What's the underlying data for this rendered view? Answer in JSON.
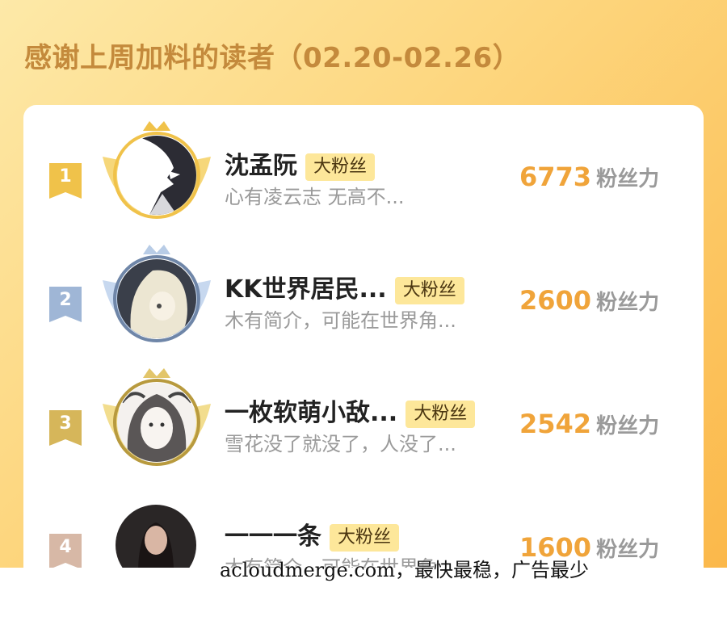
{
  "header": {
    "title": "感谢上周加料的读者（02.20-02.26）"
  },
  "colors": {
    "gold": "#f0c24a",
    "silver": "#9fb6d6",
    "bronze": "#d6b65a",
    "fourth": "#d7b8a6",
    "score": "#f0a43a"
  },
  "readers": [
    {
      "rank": "1",
      "name": "沈孟阮",
      "badge": "大粉丝",
      "bio": "心有凌云志 无高不...",
      "score": "6773",
      "score_label": "粉丝力",
      "avatar_icon": "anime-boy-avatar"
    },
    {
      "rank": "2",
      "name": "KK世界居民...",
      "badge": "大粉丝",
      "bio": "木有简介，可能在世界角...",
      "score": "2600",
      "score_label": "粉丝力",
      "avatar_icon": "anime-girl-avatar"
    },
    {
      "rank": "3",
      "name": "一枚软萌小敌...",
      "badge": "大粉丝",
      "bio": "雪花没了就没了，人没了...",
      "score": "2542",
      "score_label": "粉丝力",
      "avatar_icon": "sketch-girl-avatar"
    },
    {
      "rank": "4",
      "name": "一一一条",
      "badge": "大粉丝",
      "bio": "木有简介，可能在世界角...",
      "score": "1600",
      "score_label": "粉丝力",
      "avatar_icon": "photo-woman-avatar"
    }
  ],
  "watermark": "acloudmerge.com，最快最稳，广告最少"
}
